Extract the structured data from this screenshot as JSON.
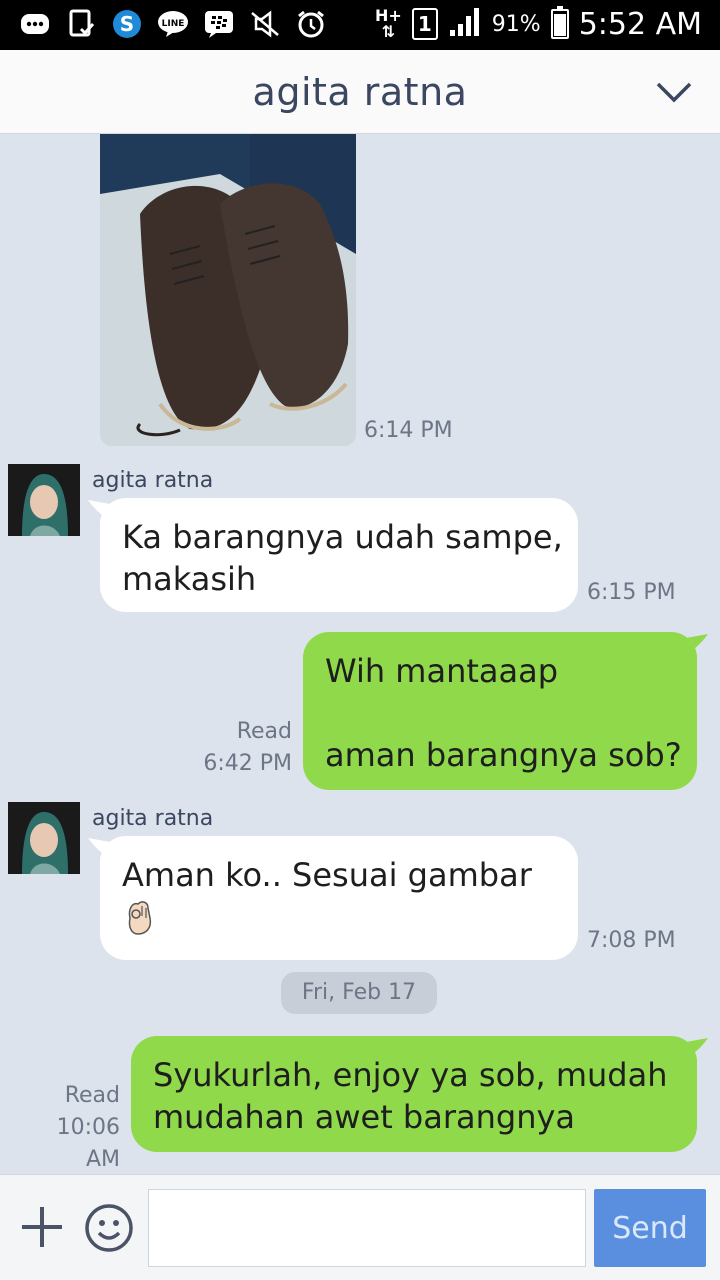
{
  "status_bar": {
    "battery": "91%",
    "time": "5:52 AM",
    "sim_slot": "1",
    "network": "H+",
    "icons": [
      "messages-icon",
      "tablet-icon",
      "skype-icon",
      "line-icon",
      "bbm-icon",
      "mute-icon",
      "alarm-icon",
      "network-icon",
      "sim-icon",
      "signal-icon",
      "battery-icon"
    ]
  },
  "header": {
    "title": "agita ratna",
    "chevron_icon": "chevron-down-icon"
  },
  "messages": {
    "photo": {
      "time": "6:14 PM"
    },
    "m1": {
      "sender": "agita ratna",
      "line1": "Ka barangnya udah sampe,",
      "line2": "makasih",
      "time": "6:15 PM"
    },
    "m2": {
      "read": "Read",
      "time": "6:42 PM",
      "line1": "Wih mantaaap",
      "line2": "aman barangnya sob?"
    },
    "m3": {
      "sender": "agita ratna",
      "line1": "Aman ko.. Sesuai gambar",
      "emoji": "ok-hand-icon",
      "time": "7:08 PM"
    },
    "date_separator": "Fri, Feb 17",
    "m4": {
      "read": "Read",
      "time": "10:06 AM",
      "line1": "Syukurlah, enjoy ya sob, mudah",
      "line2": "mudahan awet barangnya"
    }
  },
  "input_bar": {
    "placeholder": "",
    "send_label": "Send",
    "plus_icon": "plus-icon",
    "emoji_icon": "smiley-icon"
  },
  "colors": {
    "background": "#dde3ec",
    "incoming_bubble": "#ffffff",
    "outgoing_bubble": "#8fd94a",
    "send_button": "#5a8fe0",
    "header_text": "#3b4760"
  }
}
